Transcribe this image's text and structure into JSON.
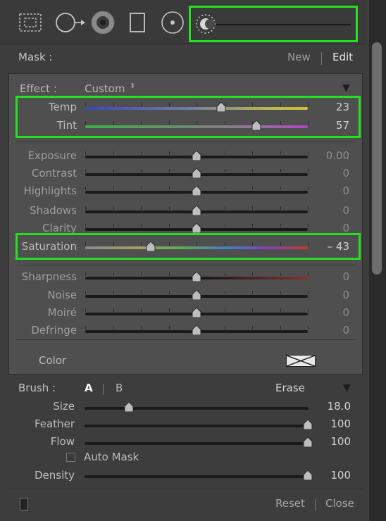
{
  "toolbar": {
    "tools": [
      "graduated-filter-tool",
      "spot-removal-tool",
      "red-eye-tool",
      "radial-filter-tool",
      "adjustment-brush-tool",
      "range-mask-slider"
    ]
  },
  "mask": {
    "label": "Mask :",
    "new_label": "New",
    "edit_label": "Edit"
  },
  "effect": {
    "label": "Effect :",
    "preset": "Custom",
    "preset_arrows": "⬍",
    "collapse_icon": "▼"
  },
  "sliders": [
    {
      "label": "Temp",
      "value": "23",
      "position": 0.61,
      "track": "temp"
    },
    {
      "label": "Tint",
      "value": "57",
      "position": 0.77,
      "track": "tint"
    },
    {
      "label": "Exposure",
      "value": "0.00",
      "position": 0.5,
      "track": "plain"
    },
    {
      "label": "Contrast",
      "value": "0",
      "position": 0.5,
      "track": "plain"
    },
    {
      "label": "Highlights",
      "value": "0",
      "position": 0.5,
      "track": "plain"
    },
    {
      "label": "Shadows",
      "value": "0",
      "position": 0.5,
      "track": "plain"
    },
    {
      "label": "Clarity",
      "value": "0",
      "position": 0.5,
      "track": "plain"
    },
    {
      "label": "Saturation",
      "value": "– 43",
      "position": 0.295,
      "track": "saturation"
    },
    {
      "label": "Sharpness",
      "value": "0",
      "position": 0.5,
      "track": "sharpness"
    },
    {
      "label": "Noise",
      "value": "0",
      "position": 0.5,
      "track": "plain"
    },
    {
      "label": "Moiré",
      "value": "0",
      "position": 0.5,
      "track": "plain"
    },
    {
      "label": "Defringe",
      "value": "0",
      "position": 0.5,
      "track": "plain"
    }
  ],
  "color": {
    "label": "Color"
  },
  "brush": {
    "label": "Brush :",
    "a_label": "A",
    "b_label": "B",
    "erase_label": "Erase",
    "collapse_icon": "▼",
    "sliders": [
      {
        "label": "Size",
        "value": "18.0",
        "position": 0.2
      },
      {
        "label": "Feather",
        "value": "100",
        "position": 1.0
      },
      {
        "label": "Flow",
        "value": "100",
        "position": 1.0
      }
    ],
    "auto_mask_label": "Auto Mask",
    "density": {
      "label": "Density",
      "value": "100",
      "position": 1.0
    }
  },
  "footer": {
    "reset_label": "Reset",
    "close_label": "Close"
  },
  "colors": {
    "highlight": "#25e021",
    "background": "#3d3d3d",
    "panel": "#4f4f4f"
  }
}
